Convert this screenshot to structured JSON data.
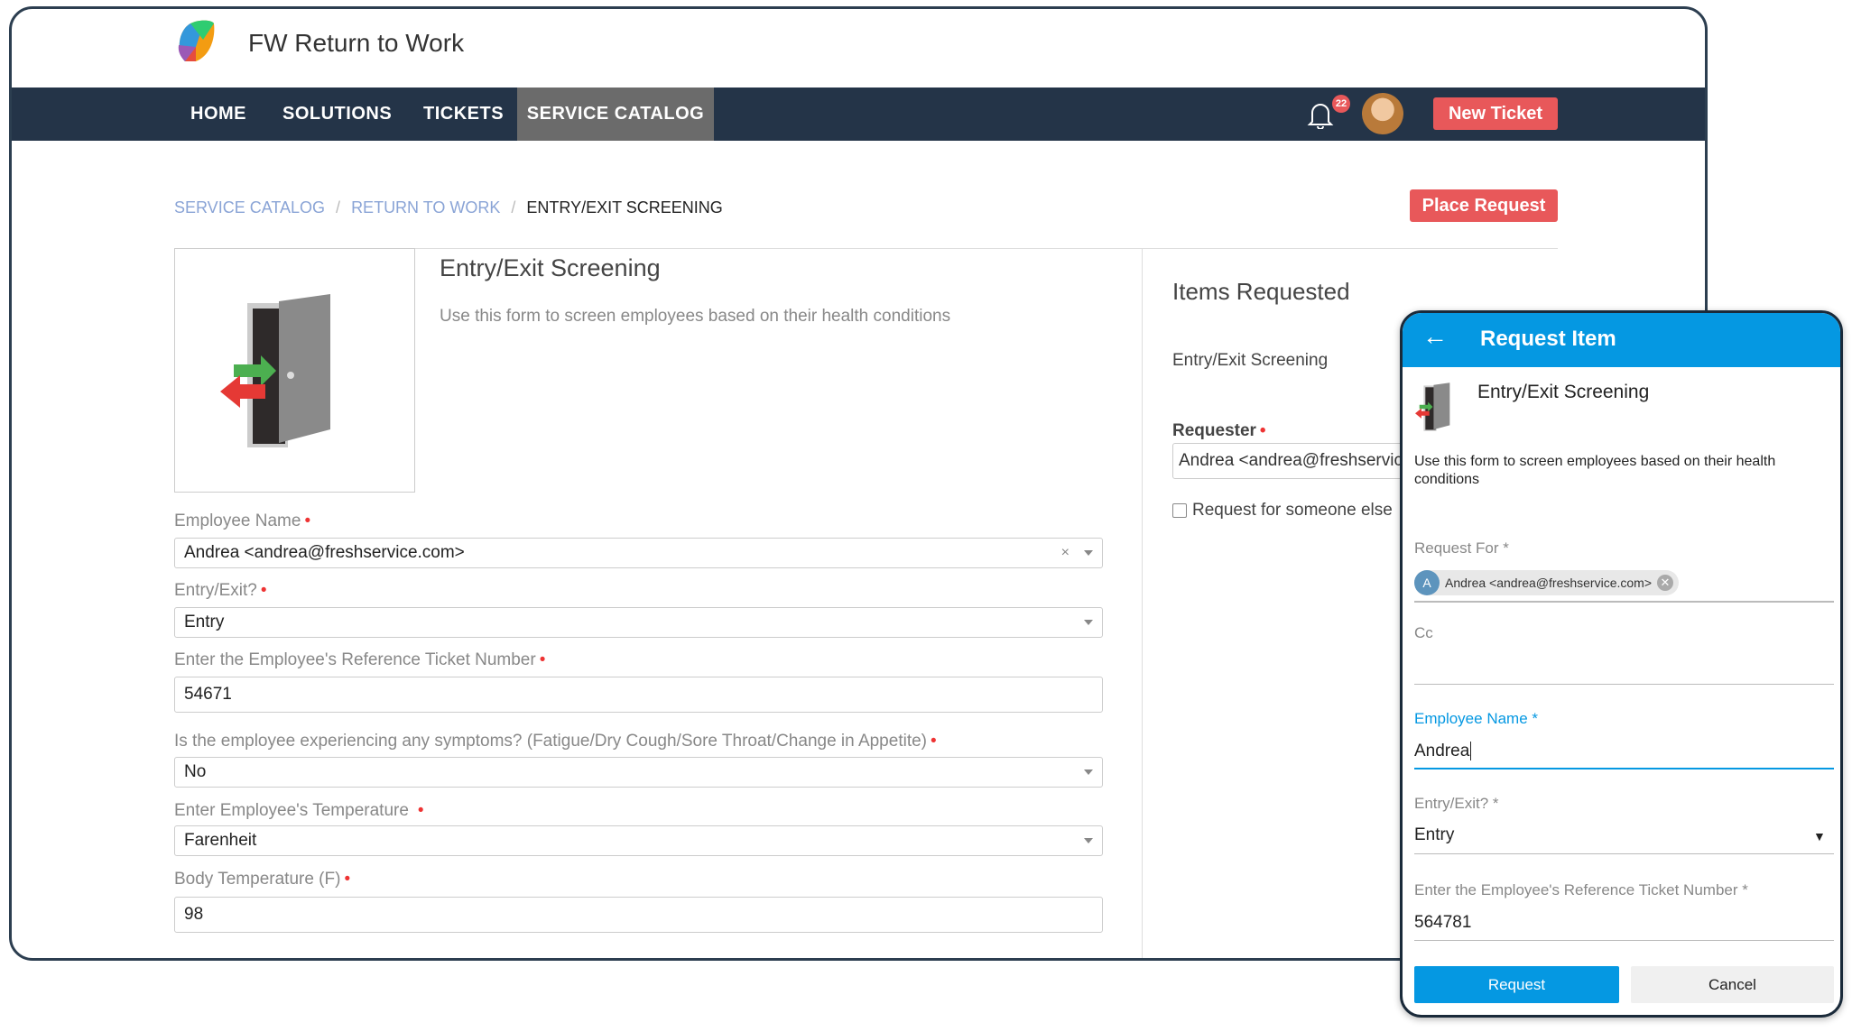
{
  "app": {
    "title": "FW Return to Work"
  },
  "nav": {
    "items": [
      "HOME",
      "SOLUTIONS",
      "TICKETS",
      "SERVICE CATALOG"
    ],
    "active": "SERVICE CATALOG",
    "notification_count": "22",
    "new_ticket": "New Ticket"
  },
  "breadcrumb": [
    "SERVICE CATALOG",
    "RETURN TO WORK",
    "ENTRY/EXIT SCREENING"
  ],
  "place_request": "Place Request",
  "item": {
    "title": "Entry/Exit Screening",
    "description": "Use this form to screen employees based on their health conditions"
  },
  "form": {
    "employee_name": {
      "label": "Employee Name",
      "value": "Andrea <andrea@freshservice.com>"
    },
    "entry_exit": {
      "label": "Entry/Exit?",
      "value": "Entry"
    },
    "ref_ticket": {
      "label": "Enter the Employee's Reference Ticket Number",
      "value": "54671"
    },
    "symptoms": {
      "label": "Is the employee experiencing any symptoms? (Fatigue/Dry Cough/Sore Throat/Change in Appetite)",
      "value": "No"
    },
    "temp_unit": {
      "label": "Enter Employee's Temperature",
      "value": "Farenheit"
    },
    "body_temp": {
      "label": "Body Temperature (F)",
      "value": "98"
    }
  },
  "side": {
    "title": "Items Requested",
    "item": "Entry/Exit Screening",
    "requester_label": "Requester",
    "requester_value": "Andrea <andrea@freshservice.com>",
    "someone_else": "Request for someone else"
  },
  "mobile": {
    "header": "Request Item",
    "title": "Entry/Exit Screening",
    "description": "Use this form to screen employees based on their health conditions",
    "request_for_label": "Request For *",
    "chip_initial": "A",
    "chip_text": "Andrea <andrea@freshservice.com>",
    "cc_label": "Cc",
    "employee_label": "Employee Name *",
    "employee_value": "Andrea",
    "entry_label": "Entry/Exit? *",
    "entry_value": "Entry",
    "ref_label": "Enter the Employee's Reference Ticket Number *",
    "ref_value": "564781",
    "request_btn": "Request",
    "cancel_btn": "Cancel"
  },
  "colors": {
    "nav": "#243448",
    "accent": "#e8585a",
    "mobile_blue": "#0598e2"
  }
}
